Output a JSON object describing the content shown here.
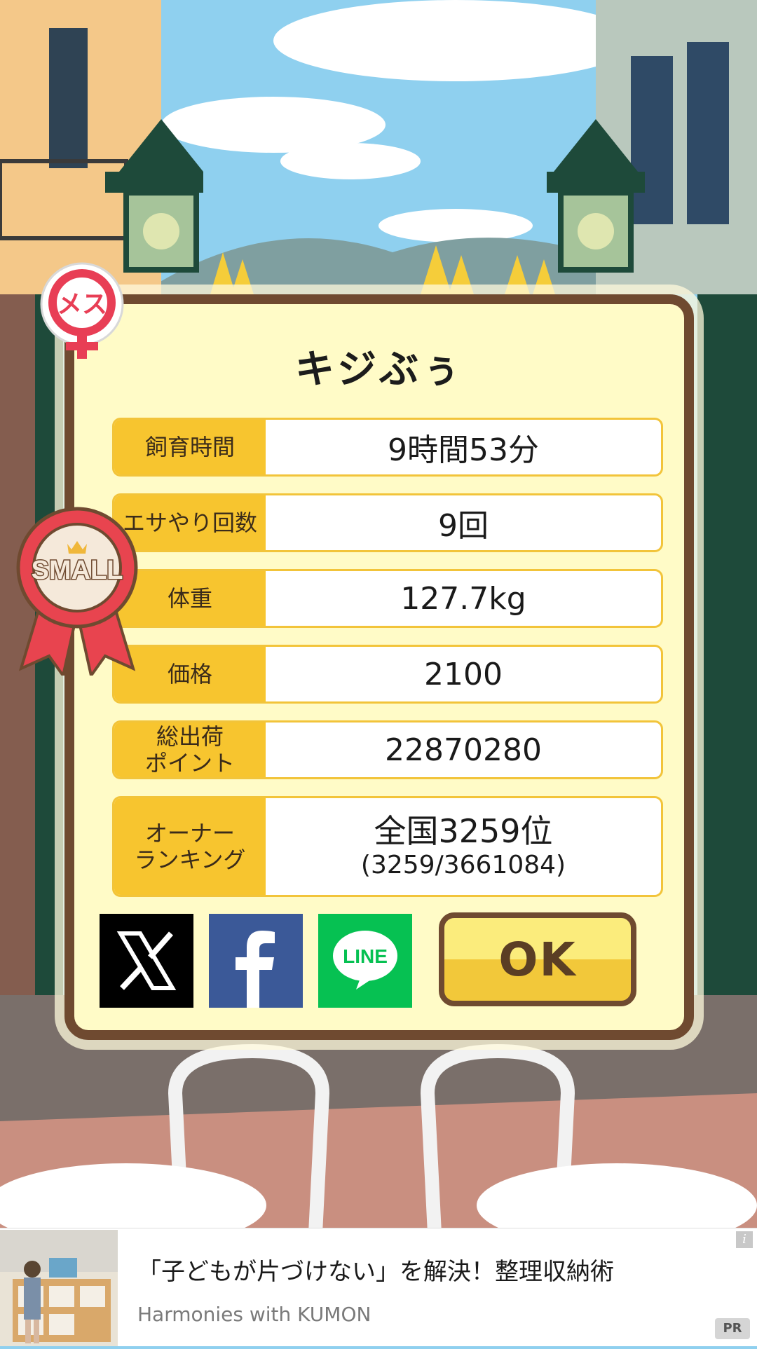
{
  "pig": {
    "name": "キジぶぅ",
    "gender_badge": "メス",
    "size_badge": "SMALL"
  },
  "stats": {
    "breeding_time_label": "飼育時間",
    "breeding_time_value": "9時間53分",
    "feed_count_label": "エサやり回数",
    "feed_count_value": "9回",
    "weight_label": "体重",
    "weight_value": "127.7kg",
    "price_label": "価格",
    "price_value": "2100",
    "shipping_points_label": "総出荷\nポイント",
    "shipping_points_value": "22870280",
    "ranking_label": "オーナー\nランキング",
    "ranking_value": "全国3259位",
    "ranking_detail": "(3259/3661084)"
  },
  "share": {
    "x_icon": "x-logo-icon",
    "facebook_icon": "facebook-logo-icon",
    "line_icon": "line-logo-icon",
    "line_text": "LINE"
  },
  "ok_label": "OK",
  "ad": {
    "headline": "「子どもが片づけない」を解決！整理収納術",
    "advertiser": "Harmonies with KUMON",
    "info_label": "i",
    "pr_label": "PR"
  },
  "colors": {
    "panel_bg": "#fffbc7",
    "panel_border": "#6f4a30",
    "label_bg": "#f7c52f",
    "female_red": "#e83e55",
    "x_black": "#000000",
    "facebook_blue": "#3b5998",
    "line_green": "#06c152"
  }
}
